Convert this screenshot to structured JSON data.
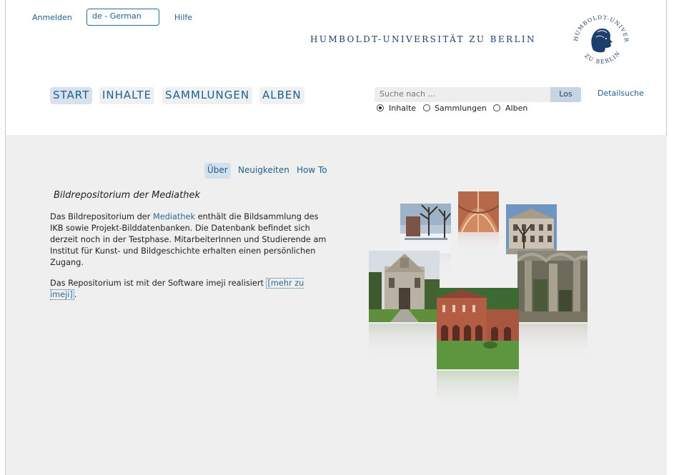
{
  "header": {
    "login_label": "Anmelden",
    "language_value": "de - German",
    "help_label": "Hilfe",
    "university_name": "HUMBOLDT-UNIVERSITÄT ZU BERLIN",
    "seal_icon": "university-seal-icon"
  },
  "nav": {
    "items": [
      {
        "label": "START",
        "active": true
      },
      {
        "label": "INHALTE",
        "active": false
      },
      {
        "label": "SAMMLUNGEN",
        "active": false
      },
      {
        "label": "ALBEN",
        "active": false
      }
    ]
  },
  "search": {
    "placeholder": "Suche nach ...",
    "button_label": "Los",
    "detail_link": "Detailsuche",
    "options": [
      {
        "label": "Inhalte",
        "checked": true
      },
      {
        "label": "Sammlungen",
        "checked": false
      },
      {
        "label": "Alben",
        "checked": false
      }
    ]
  },
  "subtabs": [
    {
      "label": "Über",
      "active": true
    },
    {
      "label": "Neuigkeiten",
      "active": false
    },
    {
      "label": "How To",
      "active": false
    }
  ],
  "content": {
    "title": "Bildrepositorium der Mediathek",
    "para1_prefix": "Das Bildrepositorium der ",
    "para1_link": "Mediathek",
    "para1_suffix": " enthält die Bildsammlung des IKB sowie Projekt-Bilddatenbanken. Die Datenbank befindet sich derzeit noch in der Testphase. MitarbeiterInnen und Studierende am Institut für Kunst- und Bildgeschichte erhalten einen persönlichen Zugang.",
    "para2_prefix": "Das Repositorium ist mit der Software imeji realisiert ",
    "para2_link": "[mehr zu imeji]",
    "para2_suffix": "."
  },
  "collage": {
    "images": [
      "winter-park-photo",
      "vaulted-cloister-photo",
      "university-building-photo",
      "baroque-church-photo",
      "ruin-columns-photo",
      "monastery-courtyard-photo"
    ]
  },
  "colors": {
    "accent": "#1f5f8b",
    "nav_bg": "#eef0f2",
    "active_bg": "#d7e2ee",
    "main_bg": "#efefef"
  }
}
